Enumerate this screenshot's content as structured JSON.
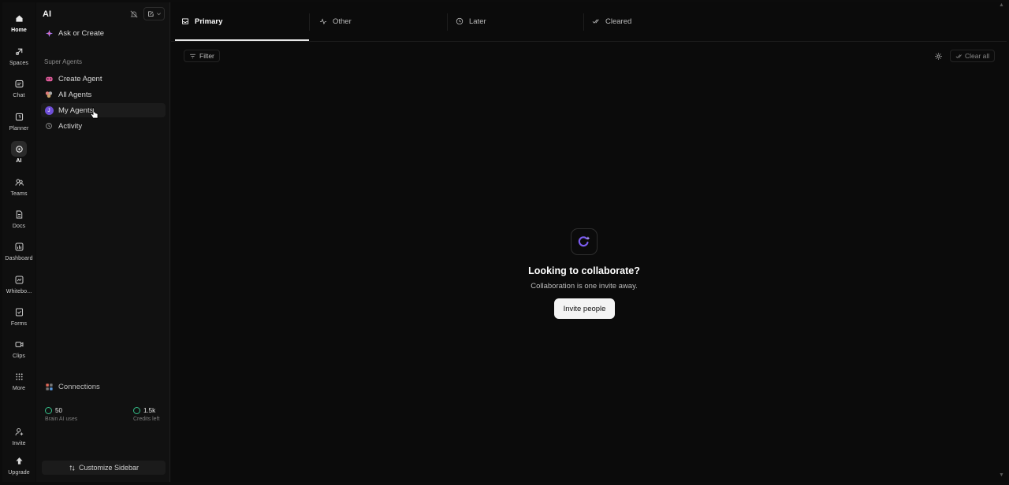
{
  "rail": {
    "items": [
      {
        "label": "Home",
        "icon": "home-icon"
      },
      {
        "label": "Spaces",
        "icon": "spaces-icon"
      },
      {
        "label": "Chat",
        "icon": "chat-icon"
      },
      {
        "label": "Planner",
        "icon": "planner-icon"
      },
      {
        "label": "AI",
        "icon": "ai-icon"
      },
      {
        "label": "Teams",
        "icon": "teams-icon"
      },
      {
        "label": "Docs",
        "icon": "docs-icon"
      },
      {
        "label": "Dashboard",
        "icon": "dashboard-icon"
      },
      {
        "label": "Whitebo...",
        "icon": "whiteboard-icon"
      },
      {
        "label": "Forms",
        "icon": "forms-icon"
      },
      {
        "label": "Clips",
        "icon": "clips-icon"
      },
      {
        "label": "More",
        "icon": "more-grid-icon"
      },
      {
        "label": "Invite",
        "icon": "invite-icon"
      },
      {
        "label": "Upgrade",
        "icon": "upgrade-icon"
      }
    ],
    "active": "AI"
  },
  "sidebar": {
    "title": "AI",
    "ask_label": "Ask or Create",
    "section_label": "Super Agents",
    "items": [
      {
        "label": "Create Agent",
        "icon": "create-agent-icon"
      },
      {
        "label": "All Agents",
        "icon": "all-agents-icon"
      },
      {
        "label": "My Agents",
        "icon": "my-agents-avatar-icon",
        "avatar_letter": "J"
      },
      {
        "label": "Activity",
        "icon": "activity-icon"
      }
    ],
    "connections_label": "Connections",
    "stats": [
      {
        "value": "50",
        "caption": "Brain AI uses"
      },
      {
        "value": "1.5k",
        "caption": "Credits left"
      }
    ],
    "customize_label": "Customize Sidebar",
    "accent_green": "#35c08a",
    "avatar_color": "#6f4fd8"
  },
  "main": {
    "tabs": [
      {
        "label": "Primary",
        "icon": "inbox-icon"
      },
      {
        "label": "Other",
        "icon": "activity-pulse-icon"
      },
      {
        "label": "Later",
        "icon": "clock-icon"
      },
      {
        "label": "Cleared",
        "icon": "double-check-icon"
      }
    ],
    "active_tab": "Primary",
    "filter_label": "Filter",
    "clear_all_label": "Clear all",
    "empty": {
      "title": "Looking to collaborate?",
      "subtitle": "Collaboration is one invite away.",
      "button_label": "Invite people",
      "icon_color": "#7b5cf0"
    }
  }
}
